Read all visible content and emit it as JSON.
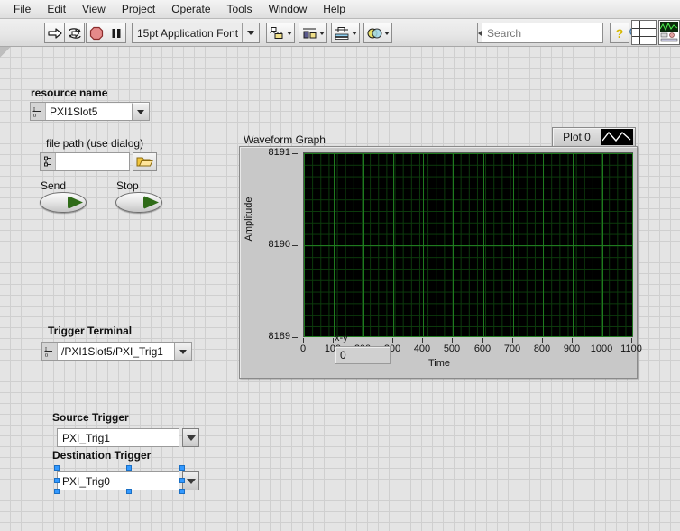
{
  "menu": {
    "items": [
      "File",
      "Edit",
      "View",
      "Project",
      "Operate",
      "Tools",
      "Window",
      "Help"
    ]
  },
  "toolbar": {
    "run_label": "run-arrow",
    "run_continuous_label": "run-continuously",
    "abort_label": "abort-execution",
    "pause_label": "pause",
    "font_selector": "15pt Application Font",
    "align_label": "align-objects",
    "distribute_label": "distribute-objects",
    "resize_label": "resize-objects",
    "reorder_label": "reorder-objects",
    "search_placeholder": "Search",
    "help_label": "?"
  },
  "panel": {
    "resource_name": {
      "label": "resource name",
      "value": "PXI1Slot5",
      "glyph": "I/O"
    },
    "file_path": {
      "label": "file path (use dialog)",
      "value": "",
      "glyph": "path"
    },
    "send_switch": {
      "label": "Send",
      "state": "on"
    },
    "stop_switch": {
      "label": "Stop",
      "state": "on"
    },
    "trigger_terminal": {
      "label": "Trigger Terminal",
      "value": "/PXI1Slot5/PXI_Trig1",
      "glyph": "I/O"
    },
    "source_trigger": {
      "label": "Source Trigger",
      "value": "PXI_Trig1"
    },
    "destination_trigger": {
      "label": "Destination Trigger",
      "value": "PXI_Trig0",
      "selected": true
    },
    "xy_indicator": {
      "label": "x-y",
      "value": "0"
    }
  },
  "chart_data": {
    "type": "line",
    "title": "Waveform Graph",
    "xlabel": "Time",
    "ylabel": "Amplitude",
    "legend": [
      "Plot 0"
    ],
    "legend_position": "top-right",
    "grid": true,
    "xlim": [
      0,
      1100
    ],
    "ylim": [
      8189,
      8191
    ],
    "xticks": [
      0,
      100,
      200,
      300,
      400,
      500,
      600,
      700,
      800,
      900,
      1000,
      1100
    ],
    "yticks": [
      8189,
      8190,
      8191
    ],
    "plot_bg": "#000000",
    "grid_color": "#1f7a1f",
    "series": [
      {
        "name": "Plot 0",
        "x": [],
        "values": []
      }
    ]
  }
}
